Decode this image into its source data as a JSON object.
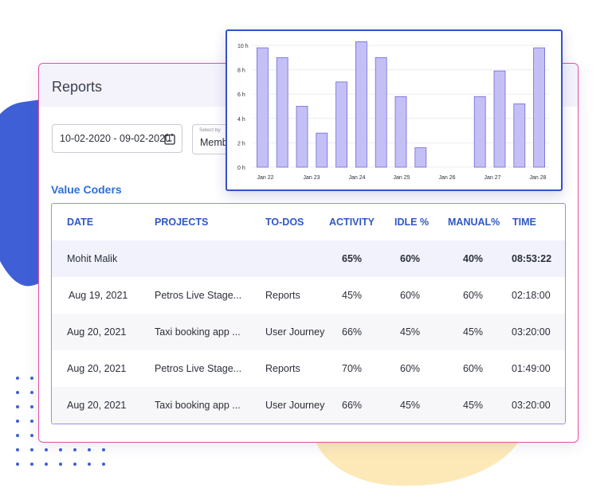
{
  "header": {
    "title": "Reports"
  },
  "filters": {
    "date_range": "10-02-2020 - 09-02-2020",
    "select_label": "Select by",
    "select_value": "Memb"
  },
  "organization": "Value Coders",
  "table": {
    "columns": [
      "DATE",
      "PROJECTS",
      "TO-DOS",
      "ACTIVITY",
      "IDLE %",
      "MANUAL%",
      "TIME"
    ],
    "summary": {
      "name": "Mohit Malik",
      "activity": "65%",
      "idle": "60%",
      "manual": "40%",
      "time": "08:53:22"
    },
    "rows": [
      {
        "date": "Aug 19, 2021",
        "project": "Petros Live Stage...",
        "todo": "Reports",
        "activity": "45%",
        "idle": "60%",
        "manual": "60%",
        "time": "02:18:00"
      },
      {
        "date": "Aug 20, 2021",
        "project": "Taxi booking app ...",
        "todo": "User Journey",
        "activity": "66%",
        "idle": "45%",
        "manual": "45%",
        "time": "03:20:00"
      },
      {
        "date": "Aug 20, 2021",
        "project": "Petros Live Stage...",
        "todo": "Reports",
        "activity": "70%",
        "idle": "60%",
        "manual": "60%",
        "time": "01:49:00"
      },
      {
        "date": "Aug 20, 2021",
        "project": "Taxi booking app ...",
        "todo": "User Journey",
        "activity": "66%",
        "idle": "45%",
        "manual": "45%",
        "time": "03:20:00"
      }
    ]
  },
  "colors": {
    "accent": "#2f56c9",
    "card_border": "#e44fa8",
    "bar_fill": "#c4c0f5",
    "bar_stroke": "#6f68d8"
  },
  "chart_data": {
    "type": "bar",
    "y_tick_labels": [
      "0 h",
      "2 h",
      "4 h",
      "6 h",
      "8 h",
      "10 h"
    ],
    "ylim": [
      0,
      10
    ],
    "x_tick_labels": [
      "Jan 22",
      "Jan 23",
      "Jan 24",
      "Jan 25",
      "Jan 26",
      "Jan 27",
      "Jan 28"
    ],
    "values": [
      9.8,
      9.0,
      5.0,
      2.8,
      7.0,
      10.3,
      9.0,
      5.8,
      1.6,
      0,
      0,
      5.8,
      7.9,
      5.2,
      9.8
    ],
    "grid": true,
    "legend": "none"
  }
}
